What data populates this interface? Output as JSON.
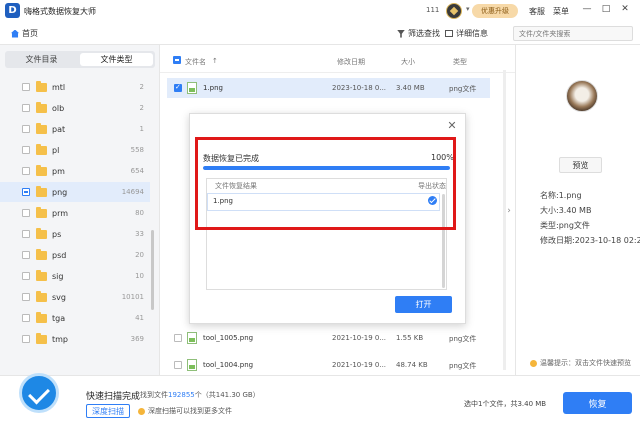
{
  "app": {
    "title": "嗨格式数据恢复大师",
    "count": "111",
    "upgrade": "优惠升级",
    "service": "客服",
    "menu": "菜单"
  },
  "window": {
    "minimize": "—",
    "maximize": "□",
    "close": "✕"
  },
  "toolbar": {
    "home": "首页",
    "filter": "筛选查找",
    "detail": "详细信息",
    "search_placeholder": "文件/文件夹搜索"
  },
  "tabs": {
    "dir": "文件目录",
    "type": "文件类型"
  },
  "tree": [
    {
      "label": "mtl",
      "count": "2"
    },
    {
      "label": "olb",
      "count": "2"
    },
    {
      "label": "pat",
      "count": "1"
    },
    {
      "label": "pl",
      "count": "558"
    },
    {
      "label": "pm",
      "count": "654"
    },
    {
      "label": "png",
      "count": "14694"
    },
    {
      "label": "prm",
      "count": "80"
    },
    {
      "label": "ps",
      "count": "33"
    },
    {
      "label": "psd",
      "count": "20"
    },
    {
      "label": "sig",
      "count": "10"
    },
    {
      "label": "svg",
      "count": "10101"
    },
    {
      "label": "tga",
      "count": "41"
    },
    {
      "label": "tmp",
      "count": "369"
    }
  ],
  "list": {
    "headers": {
      "name": "文件名",
      "date": "修改日期",
      "size": "大小",
      "type": "类型"
    },
    "rows": [
      {
        "name": "1.png",
        "date": "2023-10-18 0...",
        "size": "3.40 MB",
        "type": "png文件"
      },
      {
        "name": "tool_1005.png",
        "date": "2021-10-19 0...",
        "size": "1.55 KB",
        "type": "png文件"
      },
      {
        "name": "tool_1004.png",
        "date": "2021-10-19 0...",
        "size": "48.74 KB",
        "type": "png文件"
      }
    ]
  },
  "preview": {
    "button": "预览",
    "name": "名称:1.png",
    "size": "大小:3.40 MB",
    "type": "类型:png文件",
    "modified": "修改日期:2023-10-18 02:2...",
    "tip": "温馨提示：双击文件快速预览"
  },
  "dialog": {
    "title": "数据恢复已完成",
    "percent": "100%",
    "progress": 1.0,
    "col_result": "文件恢复结果",
    "col_status": "导出状态",
    "file": "1.png",
    "open": "打开",
    "close": "✕"
  },
  "bottom": {
    "title": "快速扫描完成",
    "found_prefix": "找到文件",
    "found_count": "192855",
    "found_suffix": "个（共141.30 GB）",
    "deep_scan": "深度扫描",
    "deep_tip": "深度扫描可以找到更多文件",
    "status": "选中1个文件，共3.40 MB",
    "recover": "恢复"
  },
  "colors": {
    "accent": "#2f7ef5",
    "annotation": "#e01818",
    "folder": "#f5c04a"
  }
}
